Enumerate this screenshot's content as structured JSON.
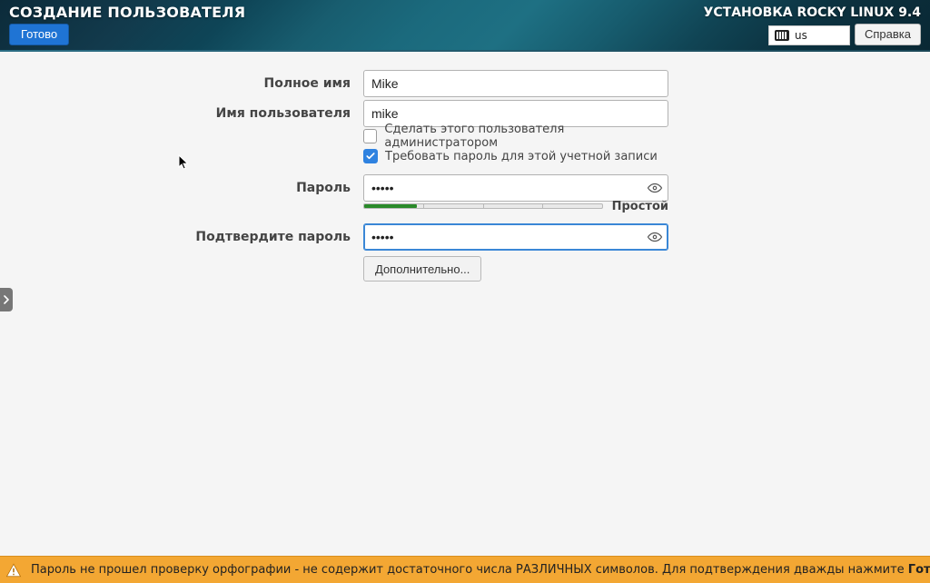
{
  "header": {
    "page_title": "СОЗДАНИЕ ПОЛЬЗОВАТЕЛЯ",
    "done_label": "Готово",
    "installer_title": "УСТАНОВКА ROCKY LINUX 9.4",
    "keyboard_layout": "us",
    "help_label": "Справка"
  },
  "form": {
    "full_name_label": "Полное имя",
    "full_name_value": "Mike",
    "username_label": "Имя пользователя",
    "username_value": "mike",
    "make_admin_label": "Сделать этого пользователя администратором",
    "make_admin_checked": false,
    "require_password_label": "Требовать пароль для этой учетной записи",
    "require_password_checked": true,
    "password_label": "Пароль",
    "password_value": "•••••",
    "confirm_label": "Подтвердите пароль",
    "confirm_value": "•••••",
    "strength_label": "Простой",
    "strength_percent": 22,
    "advanced_label": "Дополнительно..."
  },
  "warning": {
    "text_1": "Пароль не прошел проверку орфографии - не содержит достаточного числа РАЗЛИЧНЫХ символов. Для подтверждения дважды нажмите ",
    "bold": "Готово",
    "text_2": "."
  }
}
